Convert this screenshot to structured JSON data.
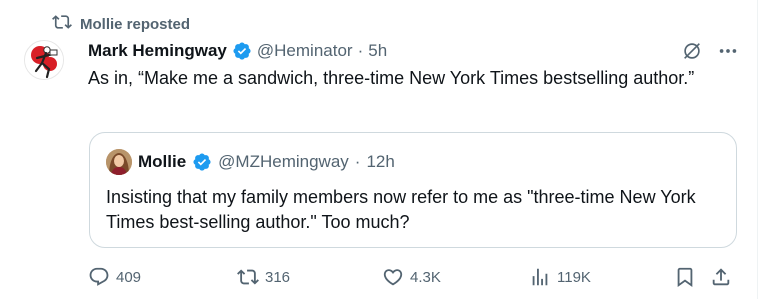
{
  "repost": {
    "label": "Mollie reposted",
    "icon": "repost-icon"
  },
  "tweet": {
    "author_name": "Mark Hemingway",
    "handle": "@Heminator",
    "separator": "·",
    "time": "5h",
    "text": "As in, “Make me a sandwich, three-time New York Times bestselling author.”"
  },
  "quote": {
    "author_name": "Mollie",
    "handle": "@MZHemingway",
    "separator": "·",
    "time": "12h",
    "text": "Insisting that my family members now refer to me as \"three-time New York Times best-selling author.\" Too much?"
  },
  "actions": {
    "replies": "409",
    "reposts": "316",
    "likes": "4.3K",
    "views": "119K"
  },
  "colors": {
    "verified": "#1d9bf0",
    "muted": "#536471",
    "text": "#0f1419",
    "border": "#cfd9de"
  }
}
